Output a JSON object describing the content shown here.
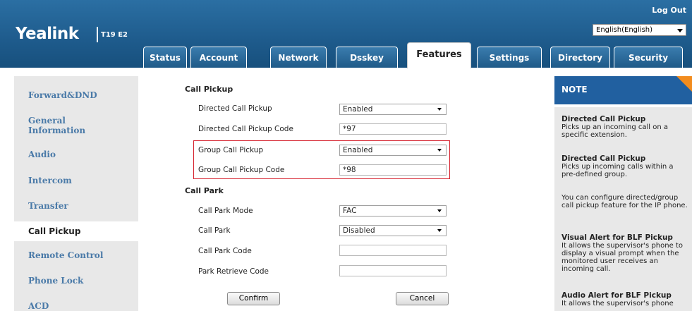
{
  "header": {
    "brand": "Yealink",
    "model": "T19 E2",
    "logout": "Log Out",
    "language": "English(English)"
  },
  "tabs": [
    {
      "label": "Status"
    },
    {
      "label": "Account"
    },
    {
      "label": "Network"
    },
    {
      "label": "Dsskey"
    },
    {
      "label": "Features",
      "active": true
    },
    {
      "label": "Settings"
    },
    {
      "label": "Directory"
    },
    {
      "label": "Security"
    }
  ],
  "sidebar": {
    "items": [
      {
        "label": "Forward&DND"
      },
      {
        "label": "General\nInformation"
      },
      {
        "label": "Audio"
      },
      {
        "label": "Intercom"
      },
      {
        "label": "Transfer"
      },
      {
        "label": "Call Pickup",
        "active": true
      },
      {
        "label": "Remote Control"
      },
      {
        "label": "Phone Lock"
      },
      {
        "label": "ACD"
      }
    ]
  },
  "main": {
    "call_pickup": {
      "title": "Call Pickup",
      "directed_label": "Directed Call Pickup",
      "directed_value": "Enabled",
      "directed_code_label": "Directed Call Pickup Code",
      "directed_code_value": "*97",
      "group_label": "Group Call Pickup",
      "group_value": "Enabled",
      "group_code_label": "Group Call Pickup Code",
      "group_code_value": "*98"
    },
    "call_park": {
      "title": "Call Park",
      "mode_label": "Call Park Mode",
      "mode_value": "FAC",
      "park_label": "Call Park",
      "park_value": "Disabled",
      "code_label": "Call Park Code",
      "code_value": "",
      "retrieve_label": "Park Retrieve Code",
      "retrieve_value": ""
    },
    "confirm_label": "Confirm",
    "cancel_label": "Cancel"
  },
  "note": {
    "title": "NOTE",
    "p1_title": "Directed Call Pickup",
    "p1_text": "Picks up an incoming call on a specific extension.",
    "p2_title": "Directed Call Pickup",
    "p2_text": "Picks up incoming calls within a pre-defined group.",
    "p3_text": "You can configure directed/group call pickup feature for the IP phone.",
    "p4_title": "Visual Alert for BLF Pickup",
    "p4_text": "It allows the supervisor's phone to display a visual prompt when the monitored user receives an incoming call.",
    "p5_title": "Audio Alert for BLF Pickup",
    "p5_text": "It allows the supervisor's phone"
  },
  "colors": {
    "header_blue": "#1e5b8c",
    "link_blue": "#4a7aa8",
    "highlight_red": "#d6232f",
    "note_orange": "#f28c1e"
  }
}
